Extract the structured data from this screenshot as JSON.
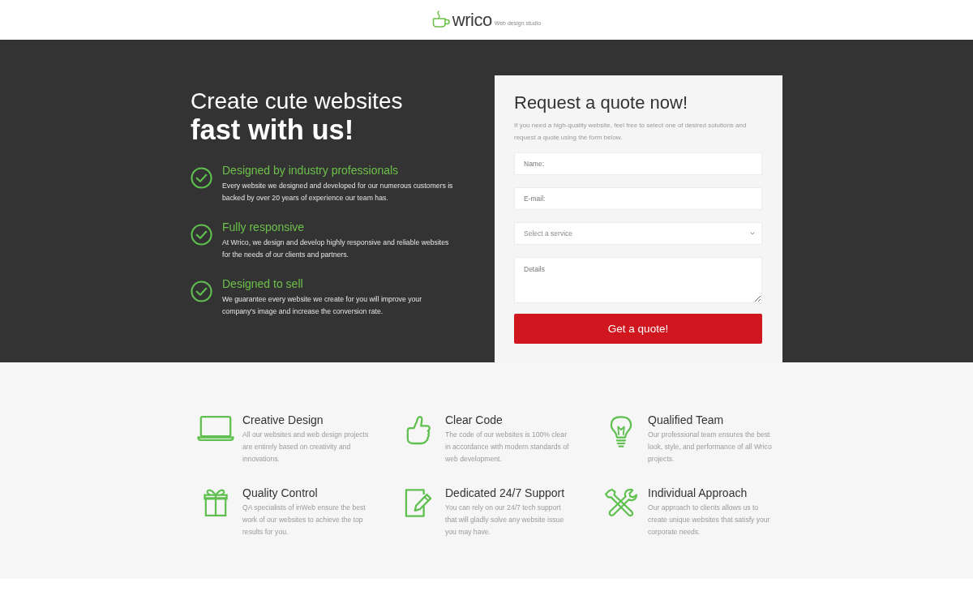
{
  "header": {
    "logo": {
      "name": "wrico",
      "tagline": "Web design studio"
    }
  },
  "hero": {
    "title": {
      "lead": "Create cute websites",
      "emphasis": "fast with us!"
    },
    "benefits": [
      {
        "title": "Designed by industry professionals",
        "text": "Every website we designed and developed for our numerous customers is backed by over 20 years of experience our team has."
      },
      {
        "title": "Fully responsive",
        "text": "At Wrico, we design and develop highly responsive and reliable websites for the needs of our clients and partners."
      },
      {
        "title": "Designed to sell",
        "text": "We guarantee every website we create for you will improve your company's image and increase the conversion rate."
      }
    ]
  },
  "quote_form": {
    "title": "Request a quote now!",
    "intro": "If you need a high-quality website, feel free to select one of desired solutions and request a quote using the form below.",
    "fields": [
      {
        "kind": "text",
        "placeholder": "Name:"
      },
      {
        "kind": "text",
        "placeholder": "E-mail:"
      },
      {
        "kind": "select",
        "placeholder": "Select a service"
      },
      {
        "kind": "textarea",
        "placeholder": "Details"
      }
    ],
    "submit": "Get a quote!"
  },
  "features": [
    {
      "title": "Creative Design",
      "text": "All our websites and web design projects are entirely based on creativity and innovations."
    },
    {
      "title": "Clear Code",
      "text": "The code of our websites is 100% clear in accordance with modern standards of web development."
    },
    {
      "title": "Qualified Team",
      "text": "Our professional team ensures the best look, style, and performance of all Wrico projects."
    },
    {
      "title": "Quality Control",
      "text": "QA specialists of inWeb ensure the best work of our websites to achieve the top results for you."
    },
    {
      "title": "Dedicated 24/7 Support",
      "text": "You can rely on our 24/7 tech support that will gladly solve any website issue you may have."
    },
    {
      "title": "Individual Approach",
      "text": "Our approach to clients allows us to create unique websites that satisfy your corporate needs."
    }
  ]
}
